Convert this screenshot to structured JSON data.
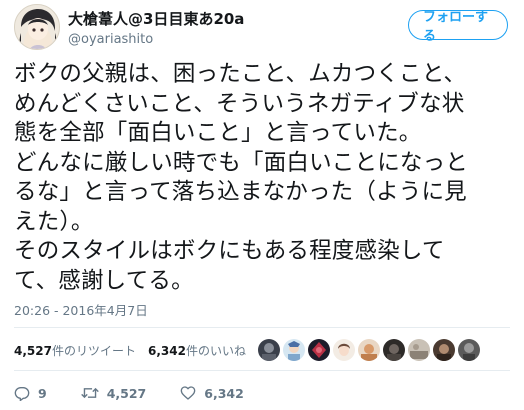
{
  "header": {
    "display_name": "大槍葦人@3日目東あ20a",
    "screen_name": "@oyariashito",
    "follow_label": "フォローする"
  },
  "tweet": {
    "lines": [
      "ボクの父親は、困ったこと、ムカつくこと、",
      "めんどくさいこと、そういうネガティブな状",
      "態を全部「面白いこと」と言っていた。",
      "どんなに厳しい時でも「面白いことになっと",
      "るな」と言って落ち込まなかった（ように見",
      "えた）。",
      "そのスタイルはボクにもある程度感染して",
      "て、感謝してる。"
    ],
    "timestamp": "20:26 - 2016年4月7日"
  },
  "stats": {
    "retweets_count": "4,527",
    "retweets_label": "件のリツイート",
    "likes_count": "6,342",
    "likes_label": "件のいいね"
  },
  "likers": [
    "liker-1",
    "liker-2",
    "liker-3",
    "liker-4",
    "liker-5",
    "liker-6",
    "liker-7",
    "liker-8",
    "liker-9"
  ],
  "actions": {
    "replies": "9",
    "retweets": "4,527",
    "likes": "6,342"
  },
  "colors": {
    "accent": "#1da1f2",
    "muted": "#657786",
    "text": "#14171a",
    "divider": "#e6ecf0"
  }
}
